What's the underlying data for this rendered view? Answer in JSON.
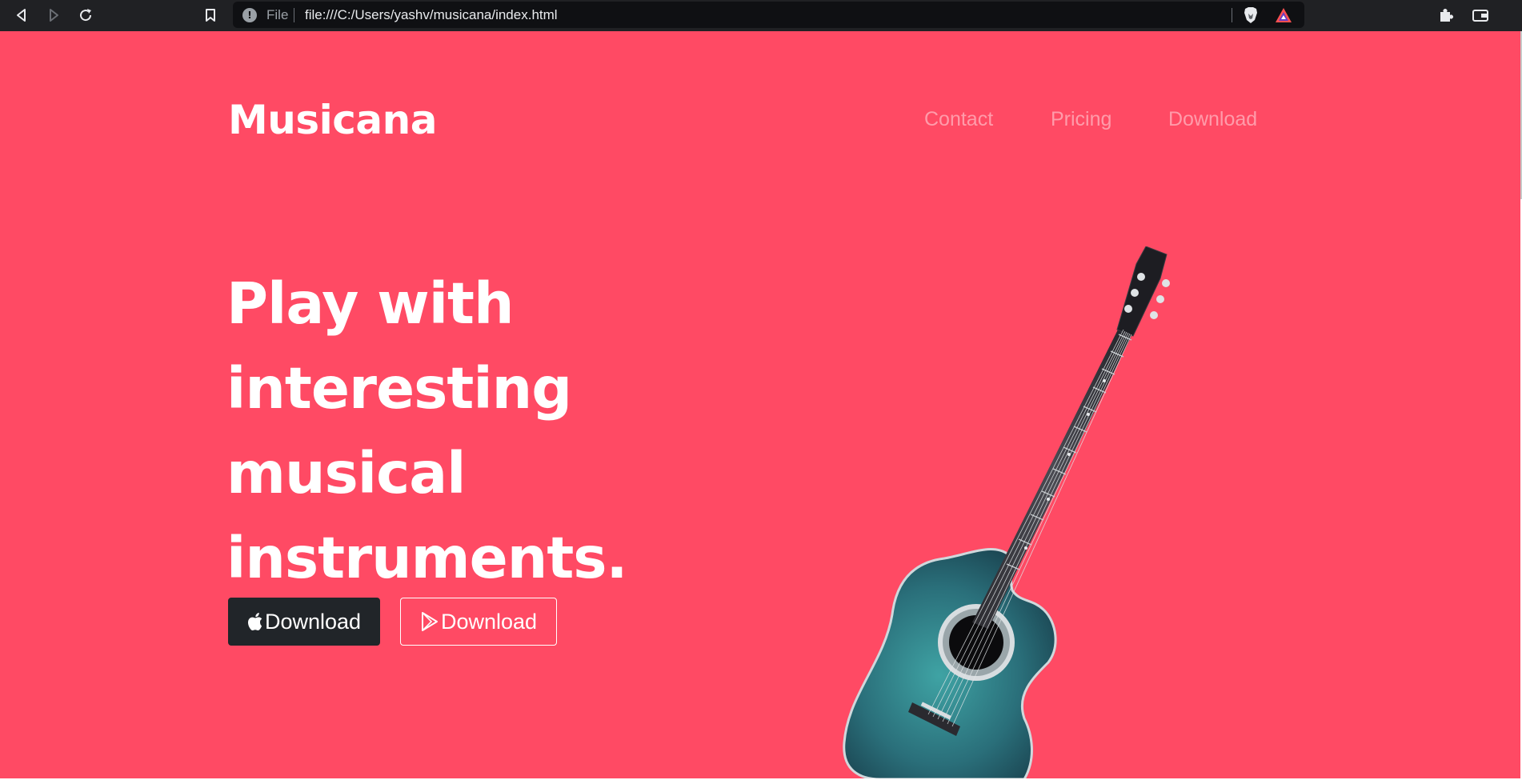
{
  "browser": {
    "url_scheme": "File",
    "url": "file:///C:/Users/yashv/musicana/index.html"
  },
  "site": {
    "brand": "Musicana",
    "nav": {
      "contact": "Contact",
      "pricing": "Pricing",
      "download": "Download"
    },
    "headline_lines": [
      "Play with",
      "interesting",
      "musical",
      "instruments."
    ],
    "buttons": {
      "apple_download": "Download",
      "play_download": "Download"
    }
  },
  "colors": {
    "page_background": "#ff4a64",
    "apple_button_background": "#212529",
    "browser_chrome": "#202124"
  },
  "icons": {
    "back": "back-icon",
    "forward": "forward-icon",
    "reload": "reload-icon",
    "bookmark": "bookmark-icon",
    "site_info": "info-icon",
    "brave_shields": "brave-lion-icon",
    "brave_rewards": "brave-rewards-triangle-icon",
    "extensions": "puzzle-piece-icon",
    "wallet": "wallet-icon",
    "apple": "apple-icon",
    "google_play": "play-store-icon"
  }
}
